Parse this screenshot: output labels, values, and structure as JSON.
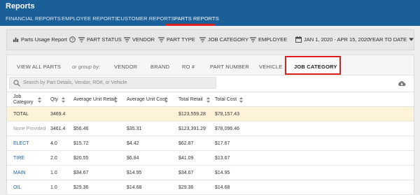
{
  "app": {
    "title": "Reports"
  },
  "nav": {
    "tabs": [
      {
        "label": "FINANCIAL REPORTS"
      },
      {
        "label": "EMPLOYEE REPORTS"
      },
      {
        "label": "CUSTOMER REPORTS"
      },
      {
        "label": "PARTS REPORTS"
      }
    ],
    "active_index": 3
  },
  "filters": {
    "report": {
      "label": "Parts Usage Report",
      "icon": "bar-chart-icon"
    },
    "items": [
      {
        "label": "PART STATUS",
        "icon": "filter-icon"
      },
      {
        "label": "VENDOR",
        "icon": "filter-icon"
      },
      {
        "label": "PART TYPE",
        "icon": "filter-icon"
      },
      {
        "label": "JOB CATEGORY",
        "icon": "filter-icon"
      },
      {
        "label": "EMPLOYEE",
        "icon": "filter-icon"
      }
    ],
    "date_range": {
      "label": "JAN 1, 2020 - APR 15, 2020",
      "icon": "calendar-icon"
    },
    "period": {
      "label": "YEAR TO DATE",
      "icon": "caret-down-icon"
    }
  },
  "grouping": {
    "view_all": "VIEW ALL PARTS",
    "or_group_by": "or group by:",
    "options": [
      "VENDOR",
      "BRAND",
      "RO #",
      "PART NUMBER",
      "VEHICLE",
      "JOB CATEGORY"
    ],
    "selected": "JOB CATEGORY"
  },
  "search": {
    "placeholder": "Search by Part Details, Vendor, RO#, or Vehicle"
  },
  "table": {
    "columns": [
      "Job Category",
      "Qty",
      "Average Unit Retail",
      "Average Unit Cost",
      "Total Retail",
      "Total Cost"
    ],
    "col1_line1": "Job",
    "col1_line2": "Category",
    "total_row": {
      "category": "TOTAL",
      "qty": "3469.4",
      "avg_retail": "",
      "avg_cost": "",
      "total_retail": "$123,559.28",
      "total_cost": "$78,157.43"
    },
    "rows": [
      {
        "category": "None Provided",
        "qty": "3461.4",
        "avg_retail": "$56.46",
        "avg_cost": "$35.31",
        "total_retail": "$123,391.29",
        "total_cost": "$78,096.46"
      },
      {
        "category": "ELECT",
        "qty": "4.0",
        "avg_retail": "$15.72",
        "avg_cost": "$4.42",
        "total_retail": "$62.87",
        "total_cost": "$17.67"
      },
      {
        "category": "TIRE",
        "qty": "2.0",
        "avg_retail": "$20.55",
        "avg_cost": "$6.84",
        "total_retail": "$41.09",
        "total_cost": "$13.67"
      },
      {
        "category": "MAIN",
        "qty": "1.0",
        "avg_retail": "$34.67",
        "avg_cost": "$14.95",
        "total_retail": "$34.67",
        "total_cost": "$14.95"
      },
      {
        "category": "OIL",
        "qty": "1.0",
        "avg_retail": "$29.36",
        "avg_cost": "$14.68",
        "total_retail": "$29.36",
        "total_cost": "$14.68"
      }
    ]
  },
  "colors": {
    "header_bg": "#1b5f98",
    "accent_red": "#dd1e1e",
    "total_row_bg": "#fdf3d8",
    "link_blue": "#1f5fa8"
  }
}
